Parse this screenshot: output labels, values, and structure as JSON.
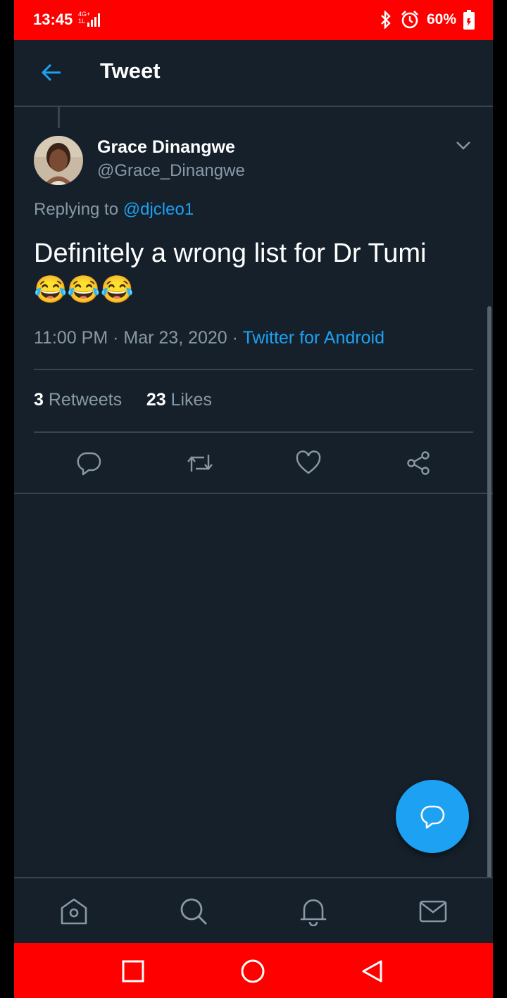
{
  "status": {
    "time": "13:45",
    "network_top": "4G+",
    "network_bottom": "1L",
    "battery": "60%"
  },
  "header": {
    "title": "Tweet"
  },
  "tweet": {
    "author_name": "Grace Dinangwe",
    "author_handle": "@Grace_Dinangwe",
    "replying_prefix": "Replying to",
    "replying_to": "@djcleo1",
    "text": "Definitely a wrong list for Dr Tumi",
    "emoji": "😂😂😂",
    "time": "11:00 PM",
    "date": "Mar 23, 2020",
    "source": "Twitter for Android",
    "separator": "·",
    "retweets_count": "3",
    "retweets_label": "Retweets",
    "likes_count": "23",
    "likes_label": "Likes"
  },
  "icons": {
    "back": "back-arrow-icon",
    "menu": "chevron-down-icon",
    "reply": "reply-icon",
    "retweet": "retweet-icon",
    "like": "heart-icon",
    "share": "share-icon",
    "compose": "compose-reply-icon",
    "home": "home-icon",
    "search": "search-icon",
    "notifications": "bell-icon",
    "messages": "mail-icon"
  },
  "colors": {
    "background": "#15202b",
    "accent": "#1da1f2",
    "muted": "#8899a6",
    "divider": "#38444d",
    "status_bar": "#ff0000"
  }
}
